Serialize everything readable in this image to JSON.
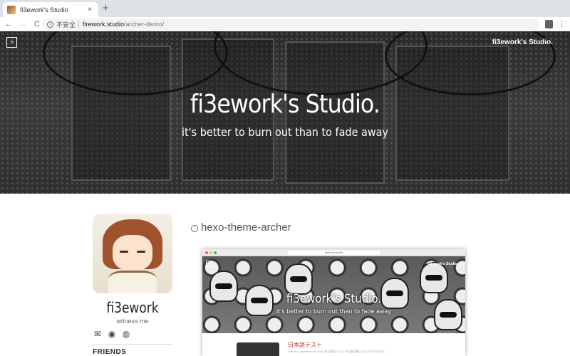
{
  "browser": {
    "tab_title": "fi3ework's Studio",
    "tab_close": "×",
    "new_tab": "+",
    "nav": {
      "back": "←",
      "forward": "→",
      "reload": "C"
    },
    "security_label": "不安全",
    "url_host": "firework.studio",
    "url_path": "/archer-demo/",
    "menu": "⋮"
  },
  "banner": {
    "toggle": ">",
    "site_name": "fi3ework's Studio.",
    "title": "fi3ework's Studio.",
    "subtitle": "it's better to burn out than to fade away"
  },
  "profile": {
    "name": "fi3ework",
    "bio": "witness me",
    "social_icons": [
      "email-icon",
      "github-icon",
      "wechat-icon"
    ],
    "social_glyphs": {
      "email": "✉",
      "github": "◉",
      "wechat": "◍"
    },
    "friends_label": "FRIENDS"
  },
  "post": {
    "icon": "−",
    "title": "hexo-theme-archer",
    "preview": {
      "url": "firework.studio",
      "toggle": ">",
      "site_name": "fi3ework's Studio.",
      "title": "fi3ework's Studio.",
      "subtitle": "it's better to burn out than to fade away",
      "post_title": "日本語テスト",
      "post_excerpt": "This is a Japanese test post. 私は昨日ついにその助力者となるようするのだ。"
    }
  },
  "colors": {
    "accent": "#c0392b",
    "chrome": "#dee1e6"
  }
}
